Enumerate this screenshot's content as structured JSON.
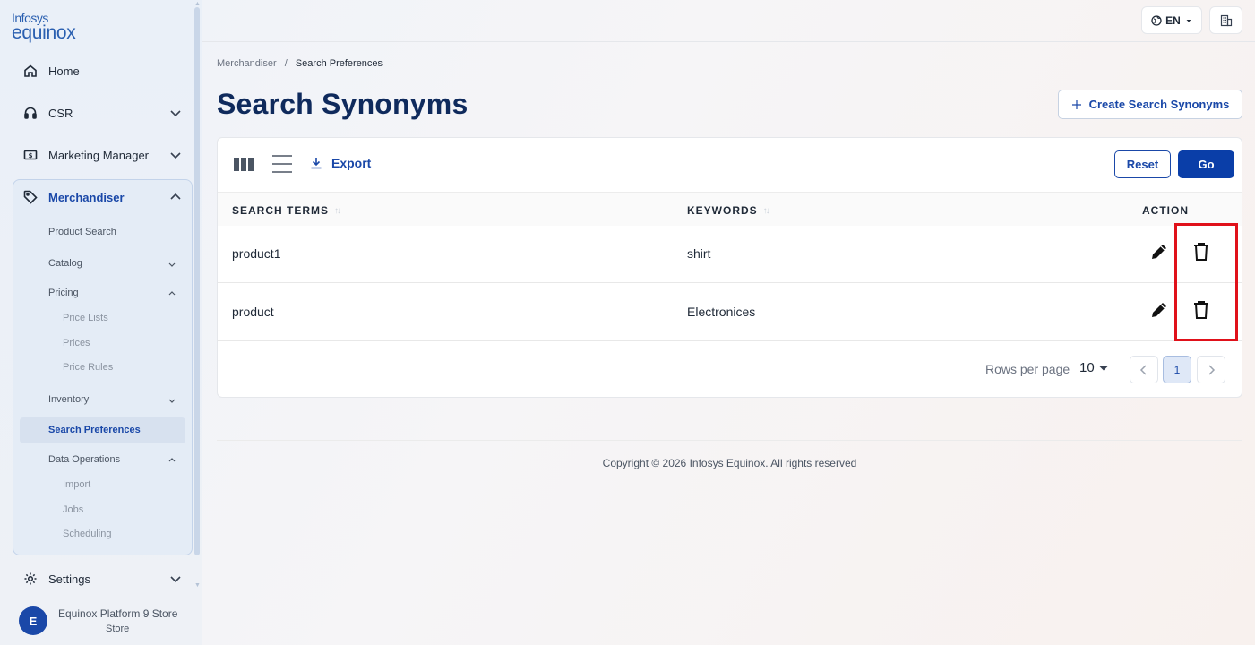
{
  "logo": {
    "line1": "Infosys",
    "line2": "equinox"
  },
  "sidebar": {
    "home": "Home",
    "csr": "CSR",
    "marketing": "Marketing Manager",
    "merchandiser": "Merchandiser",
    "product_search": "Product Search",
    "catalog": "Catalog",
    "pricing": "Pricing",
    "price_lists": "Price Lists",
    "prices": "Prices",
    "price_rules": "Price Rules",
    "inventory": "Inventory",
    "search_preferences": "Search Preferences",
    "data_operations": "Data Operations",
    "import": "Import",
    "jobs": "Jobs",
    "scheduling": "Scheduling",
    "settings": "Settings",
    "store_avatar": "E",
    "store_name": "Equinox Platform 9 Store",
    "store_type": "Store"
  },
  "topbar": {
    "language": "EN"
  },
  "breadcrumb": {
    "parent": "Merchandiser",
    "separator": "/",
    "current": "Search Preferences"
  },
  "page": {
    "title": "Search Synonyms",
    "create_button": "Create Search Synonyms"
  },
  "toolbar": {
    "export": "Export",
    "reset": "Reset",
    "go": "Go"
  },
  "table": {
    "headers": {
      "search_terms": "SEARCH TERMS",
      "keywords": "KEYWORDS",
      "action": "ACTION"
    },
    "rows": [
      {
        "search_term": "product1",
        "keywords": "shirt"
      },
      {
        "search_term": "product",
        "keywords": "Electronices"
      }
    ]
  },
  "pagination": {
    "rows_per_page_label": "Rows per page",
    "rows_per_page": "10",
    "current_page": "1"
  },
  "footer": {
    "copyright": "Copyright © 2026 Infosys Equinox. All rights reserved"
  },
  "colors": {
    "brand": "#1a48a8",
    "title": "#0f2a5c",
    "highlight": "#e0111a"
  }
}
